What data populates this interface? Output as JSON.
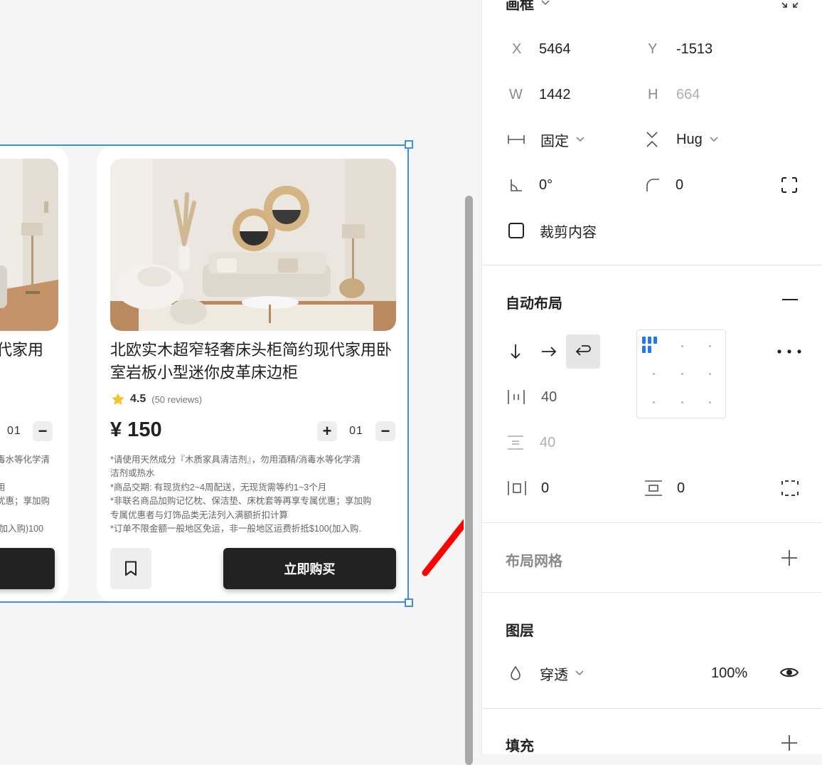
{
  "colors": {
    "accent": "#1d7bf0",
    "selection": "#3b8ef0",
    "button_dark": "#222222",
    "star": "#f4c430",
    "arrow": "#ff0000"
  },
  "canvas": {
    "card_left": {
      "title_fragment": "代家用",
      "qty": "01",
      "notes": [
        "毒水等化学清",
        "",
        "用",
        "优惠；享加购",
        "",
        "100(加入购."
      ]
    },
    "card_main": {
      "title": "北欧实木超窄轻奢床头柜简约现代家用卧室岩板小型迷你皮革床边柜",
      "rating": "4.5",
      "reviews": "(50 reviews)",
      "price": "¥ 150",
      "qty": "01",
      "plus": "+",
      "minus": "−",
      "notes": [
        "*请使用天然成分『木质家具清洁剂』，勿用酒精/消毒水等化学清",
        "洁剂或热水",
        "*商品交期: 有现货约2~4周配送，无现货需等约1~3个月",
        "*非联名商品加购记忆枕、保洁垫、床枕套等再享专属优惠；享加购",
        "专属优惠者与灯饰品类无法列入满额折扣计算",
        "*订单不限金额一般地区免运，非一般地区运费折抵$100(加入购."
      ],
      "buy_label": "立即购买"
    }
  },
  "inspector": {
    "frame": {
      "title": "画框",
      "x_label": "X",
      "x": "5464",
      "y_label": "Y",
      "y": "-1513",
      "w_label": "W",
      "w": "1442",
      "h_label": "H",
      "h": "664",
      "width_mode": "固定",
      "height_mode": "Hug",
      "rotation": "0°",
      "radius": "0",
      "clip_content": "裁剪内容"
    },
    "auto_layout": {
      "title": "自动布局",
      "gap": "40",
      "line_gap": "40",
      "padding_h": "0",
      "padding_v": "0"
    },
    "layout_grid": {
      "title": "布局网格"
    },
    "layer": {
      "title": "图层",
      "blend": "穿透",
      "opacity": "100%"
    },
    "fill": {
      "title": "填充"
    }
  }
}
